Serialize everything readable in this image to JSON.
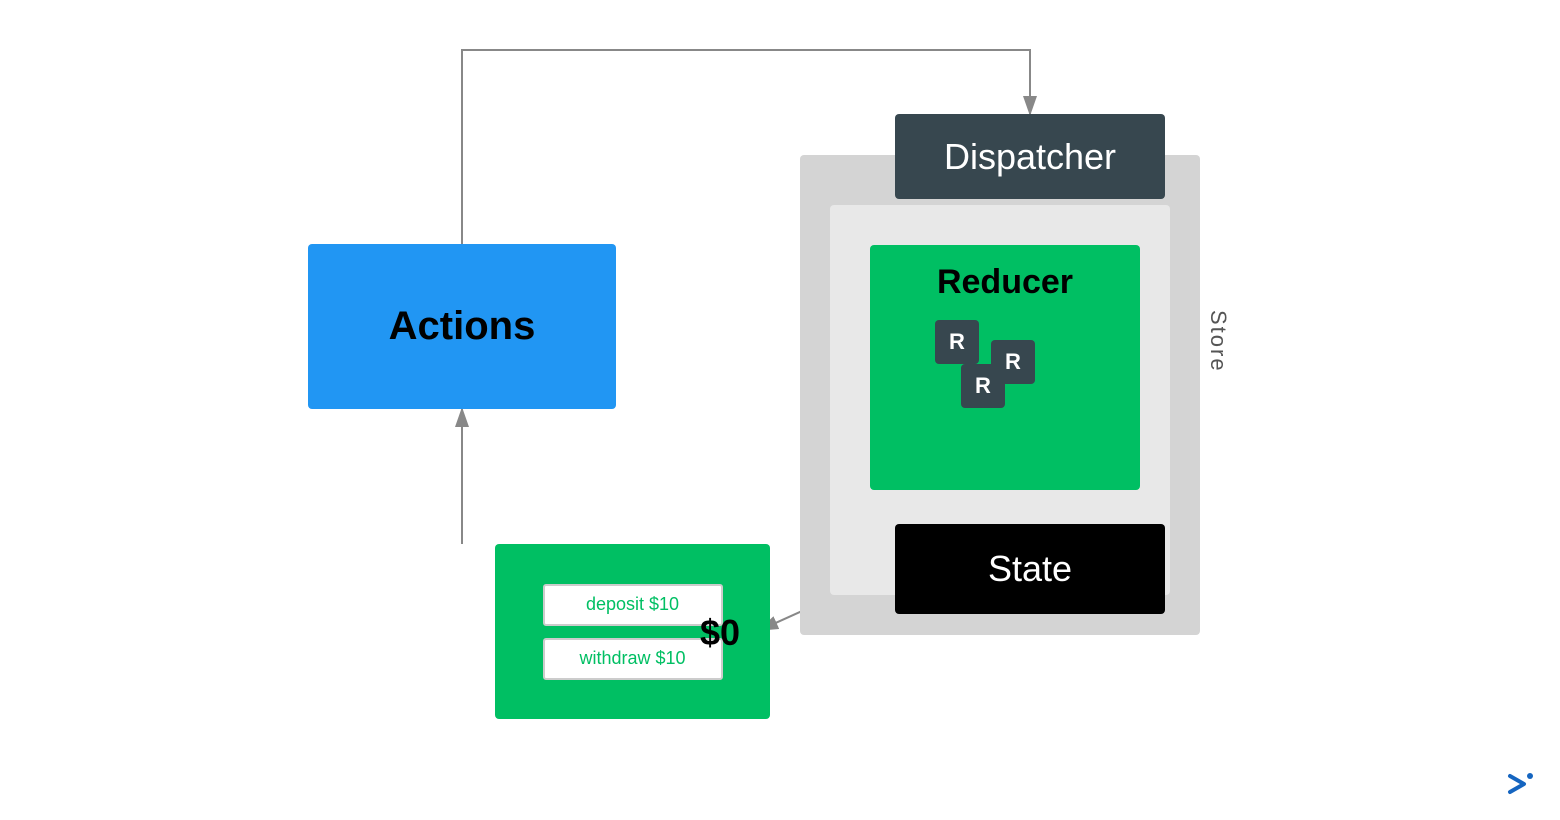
{
  "actions": {
    "label": "Actions",
    "bg": "#2196F3"
  },
  "dispatcher": {
    "label": "Dispatcher",
    "bg": "#37474F"
  },
  "reducer": {
    "label": "Reducer",
    "bg": "#00BF63",
    "chips": [
      "R",
      "R",
      "R"
    ]
  },
  "state": {
    "label": "State",
    "bg": "#000000"
  },
  "store": {
    "label": "Store"
  },
  "ui": {
    "buttons": [
      "deposit $10",
      "withdraw $10"
    ],
    "value": "$0"
  }
}
